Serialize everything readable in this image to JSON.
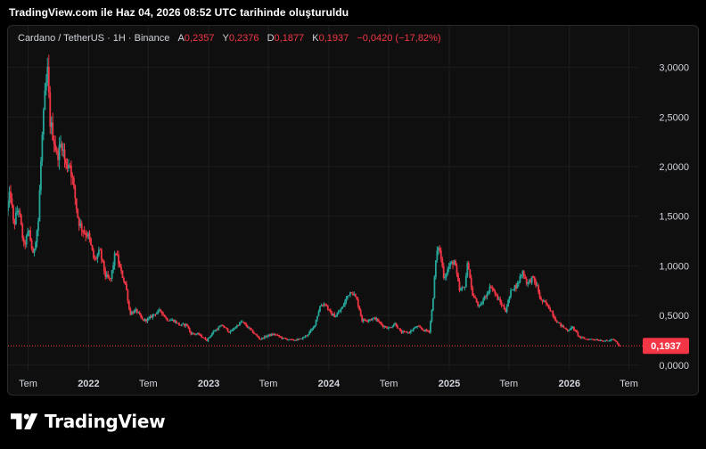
{
  "header": {
    "note": "TradingView.com ile Haz 04, 2026 08:52 UTC tarihinde oluşturuldu"
  },
  "legend": {
    "symbol": "Cardano / TetherUS · 1H · Binance",
    "open_label": "A",
    "open": "0,2357",
    "high_label": "Y",
    "high": "0,2376",
    "low_label": "D",
    "low": "0,1877",
    "close_label": "K",
    "close": "0,1937",
    "change": "−0,0420 (−17,82%)"
  },
  "brand": {
    "name": "TradingView"
  },
  "colors": {
    "up": "#26a69a",
    "down": "#f23645",
    "grid": "#1e1e1e",
    "text": "#d1d4dc",
    "price_line": "#f23645"
  },
  "chart_data": {
    "type": "candlestick",
    "series_name": "Cardano / TetherUS",
    "ylim": [
      -0.02,
      3.15
    ],
    "y_ticks": [
      {
        "value": 0.0,
        "label": "0,0000"
      },
      {
        "value": 0.5,
        "label": "0,5000"
      },
      {
        "value": 1.0,
        "label": "1,0000"
      },
      {
        "value": 1.5,
        "label": "1,5000"
      },
      {
        "value": 2.0,
        "label": "2,0000"
      },
      {
        "value": 2.5,
        "label": "2,5000"
      },
      {
        "value": 3.0,
        "label": "3,0000"
      }
    ],
    "x_range": [
      "2021-05-01",
      "2026-08-01"
    ],
    "x_ticks": [
      {
        "date": "2021-07-01",
        "label": "Tem"
      },
      {
        "date": "2022-01-01",
        "label": "2022"
      },
      {
        "date": "2022-07-01",
        "label": "Tem"
      },
      {
        "date": "2023-01-01",
        "label": "2023"
      },
      {
        "date": "2023-07-01",
        "label": "Tem"
      },
      {
        "date": "2024-01-01",
        "label": "2024"
      },
      {
        "date": "2024-07-01",
        "label": "Tem"
      },
      {
        "date": "2025-01-01",
        "label": "2025"
      },
      {
        "date": "2025-07-01",
        "label": "Tem"
      },
      {
        "date": "2026-01-01",
        "label": "2026"
      },
      {
        "date": "2026-07-01",
        "label": "Tem"
      }
    ],
    "last_price": {
      "value": 0.1937,
      "label": "0,1937"
    },
    "price_path": [
      [
        "2021-05-01",
        1.55
      ],
      [
        "2021-05-12",
        1.75
      ],
      [
        "2021-05-22",
        1.4
      ],
      [
        "2021-06-05",
        1.6
      ],
      [
        "2021-06-22",
        1.2
      ],
      [
        "2021-07-08",
        1.35
      ],
      [
        "2021-07-20",
        1.1
      ],
      [
        "2021-08-05",
        1.45
      ],
      [
        "2021-08-15",
        2.2
      ],
      [
        "2021-08-25",
        2.7
      ],
      [
        "2021-09-02",
        2.95
      ],
      [
        "2021-09-10",
        2.45
      ],
      [
        "2021-09-20",
        2.3
      ],
      [
        "2021-10-01",
        2.1
      ],
      [
        "2021-10-15",
        2.25
      ],
      [
        "2021-10-28",
        2.0
      ],
      [
        "2021-11-08",
        2.05
      ],
      [
        "2021-11-20",
        1.8
      ],
      [
        "2021-12-05",
        1.45
      ],
      [
        "2021-12-20",
        1.35
      ],
      [
        "2022-01-05",
        1.3
      ],
      [
        "2022-01-22",
        1.05
      ],
      [
        "2022-02-08",
        1.15
      ],
      [
        "2022-02-25",
        0.9
      ],
      [
        "2022-03-12",
        0.85
      ],
      [
        "2022-03-28",
        1.15
      ],
      [
        "2022-04-12",
        0.95
      ],
      [
        "2022-04-28",
        0.8
      ],
      [
        "2022-05-10",
        0.52
      ],
      [
        "2022-05-30",
        0.55
      ],
      [
        "2022-06-18",
        0.45
      ],
      [
        "2022-07-05",
        0.46
      ],
      [
        "2022-07-25",
        0.52
      ],
      [
        "2022-08-12",
        0.55
      ],
      [
        "2022-08-30",
        0.46
      ],
      [
        "2022-09-20",
        0.45
      ],
      [
        "2022-10-10",
        0.4
      ],
      [
        "2022-10-30",
        0.41
      ],
      [
        "2022-11-10",
        0.32
      ],
      [
        "2022-12-05",
        0.31
      ],
      [
        "2022-12-30",
        0.25
      ],
      [
        "2023-01-20",
        0.34
      ],
      [
        "2023-02-15",
        0.4
      ],
      [
        "2023-03-10",
        0.33
      ],
      [
        "2023-04-15",
        0.44
      ],
      [
        "2023-05-10",
        0.36
      ],
      [
        "2023-06-10",
        0.26
      ],
      [
        "2023-07-05",
        0.3
      ],
      [
        "2023-07-25",
        0.31
      ],
      [
        "2023-08-17",
        0.27
      ],
      [
        "2023-09-15",
        0.25
      ],
      [
        "2023-10-10",
        0.26
      ],
      [
        "2023-10-30",
        0.3
      ],
      [
        "2023-11-20",
        0.38
      ],
      [
        "2023-12-10",
        0.6
      ],
      [
        "2023-12-25",
        0.62
      ],
      [
        "2024-01-10",
        0.52
      ],
      [
        "2024-01-25",
        0.49
      ],
      [
        "2024-02-15",
        0.58
      ],
      [
        "2024-03-05",
        0.72
      ],
      [
        "2024-03-15",
        0.75
      ],
      [
        "2024-04-01",
        0.64
      ],
      [
        "2024-04-15",
        0.45
      ],
      [
        "2024-05-05",
        0.46
      ],
      [
        "2024-05-25",
        0.47
      ],
      [
        "2024-06-15",
        0.4
      ],
      [
        "2024-07-05",
        0.37
      ],
      [
        "2024-07-25",
        0.42
      ],
      [
        "2024-08-10",
        0.33
      ],
      [
        "2024-09-05",
        0.33
      ],
      [
        "2024-09-28",
        0.39
      ],
      [
        "2024-10-20",
        0.35
      ],
      [
        "2024-11-05",
        0.34
      ],
      [
        "2024-11-15",
        0.6
      ],
      [
        "2024-11-25",
        1.05
      ],
      [
        "2024-12-03",
        1.2
      ],
      [
        "2024-12-10",
        1.1
      ],
      [
        "2024-12-20",
        0.88
      ],
      [
        "2025-01-05",
        1.0
      ],
      [
        "2025-01-20",
        1.05
      ],
      [
        "2025-02-05",
        0.75
      ],
      [
        "2025-02-20",
        0.78
      ],
      [
        "2025-03-03",
        1.05
      ],
      [
        "2025-03-15",
        0.72
      ],
      [
        "2025-04-07",
        0.58
      ],
      [
        "2025-04-25",
        0.7
      ],
      [
        "2025-05-12",
        0.8
      ],
      [
        "2025-05-30",
        0.68
      ],
      [
        "2025-06-15",
        0.6
      ],
      [
        "2025-06-25",
        0.55
      ],
      [
        "2025-07-15",
        0.78
      ],
      [
        "2025-07-30",
        0.8
      ],
      [
        "2025-08-15",
        0.95
      ],
      [
        "2025-08-30",
        0.82
      ],
      [
        "2025-09-15",
        0.88
      ],
      [
        "2025-09-30",
        0.78
      ],
      [
        "2025-10-10",
        0.65
      ],
      [
        "2025-10-25",
        0.62
      ],
      [
        "2025-11-10",
        0.55
      ],
      [
        "2025-11-25",
        0.45
      ],
      [
        "2025-12-10",
        0.4
      ],
      [
        "2025-12-30",
        0.35
      ],
      [
        "2026-01-15",
        0.38
      ],
      [
        "2026-02-05",
        0.28
      ],
      [
        "2026-02-25",
        0.26
      ],
      [
        "2026-03-20",
        0.26
      ],
      [
        "2026-04-10",
        0.25
      ],
      [
        "2026-04-30",
        0.24
      ],
      [
        "2026-05-15",
        0.26
      ],
      [
        "2026-05-25",
        0.24
      ],
      [
        "2026-06-04",
        0.1937
      ]
    ]
  }
}
